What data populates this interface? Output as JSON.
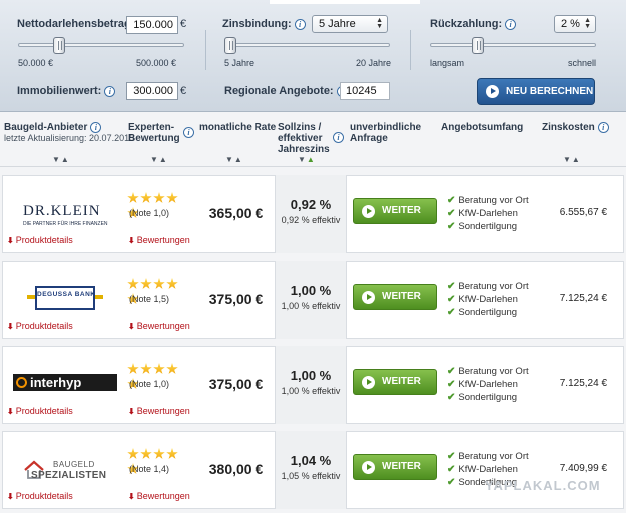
{
  "filters": {
    "loan": {
      "label": "Nettodarlehensbetrag:",
      "value": "150.000",
      "unit": "€",
      "min_label": "50.000 €",
      "max_label": "500.000 €",
      "level": 0.23
    },
    "fixation": {
      "label": "Zinsbindung:",
      "value": "5 Jahre",
      "min_label": "5 Jahre",
      "max_label": "20 Jahre",
      "level": 0.0
    },
    "repayment": {
      "label": "Rückzahlung:",
      "value": "2 %",
      "min_label": "langsam",
      "max_label": "schnell",
      "level": 0.27
    },
    "property": {
      "label": "Immobilienwert:",
      "value": "300.000",
      "unit": "€"
    },
    "regional": {
      "label": "Regionale Angebote:",
      "value": "10245"
    },
    "recalc_label": "NEU BERECHNEN"
  },
  "table": {
    "headers": {
      "provider": "Baugeld-Anbieter",
      "provider_sub": "letzte Aktualisierung: 20.07.2015",
      "rating_line1": "Experten-",
      "rating_line2": "Bewertung",
      "monthly": "monatliche Rate",
      "rate_line1": "Sollzins /",
      "rate_line2": "effektiver",
      "rate_line3": "Jahreszins",
      "request_line1": "unverbindliche",
      "request_line2": "Anfrage",
      "scope": "Angebotsumfang",
      "interest_cost": "Zinskosten"
    },
    "details_label": "Produktdetails",
    "reviews_label": "Bewertungen",
    "button_label": "WEITER",
    "rows": [
      {
        "provider": "Dr. Klein",
        "logo_text": "DR.KLEIN",
        "logo_tagline": "DIE PARTNER FÜR IHRE FINANZEN",
        "stars": 5,
        "note": "(Note 1,0)",
        "monthly": "365,00 €",
        "rate": "0,92 %",
        "effective": "0,92 % effektiv",
        "features": [
          "Beratung vor Ort",
          "KfW-Darlehen",
          "Sondertilgung"
        ],
        "cost": "6.555,67 €"
      },
      {
        "provider": "Degussa Bank",
        "logo_text": "DEGUSSA BANK",
        "stars": 5,
        "note": "(Note 1,5)",
        "monthly": "375,00 €",
        "rate": "1,00 %",
        "effective": "1,00 % effektiv",
        "features": [
          "Beratung vor Ort",
          "KfW-Darlehen",
          "Sondertilgung"
        ],
        "cost": "7.125,24 €"
      },
      {
        "provider": "Interhyp",
        "logo_text": "interhyp",
        "stars": 5,
        "note": "(Note 1,0)",
        "monthly": "375,00 €",
        "rate": "1,00 %",
        "effective": "1,00 % effektiv",
        "features": [
          "Beratung vor Ort",
          "KfW-Darlehen",
          "Sondertilgung"
        ],
        "cost": "7.125,24 €"
      },
      {
        "provider": "Baugeld Spezialisten",
        "logo_text_1": "BAUGELD",
        "logo_text_2": "SPEZIALISTEN",
        "stars": 5,
        "note": "(Note 1,4)",
        "monthly": "380,00 €",
        "rate": "1,04 %",
        "effective": "1,05 % effektiv",
        "features": [
          "Beratung vor Ort",
          "KfW-Darlehen",
          "Sondertilgung"
        ],
        "cost": "7.409,99 €"
      }
    ]
  },
  "watermark": "YAPLAKAL.COM",
  "colors": {
    "accent_blue": "#2b5e9a",
    "button_green": "#5e9e2d",
    "link_red": "#b3121a",
    "star": "#f5b81c"
  }
}
